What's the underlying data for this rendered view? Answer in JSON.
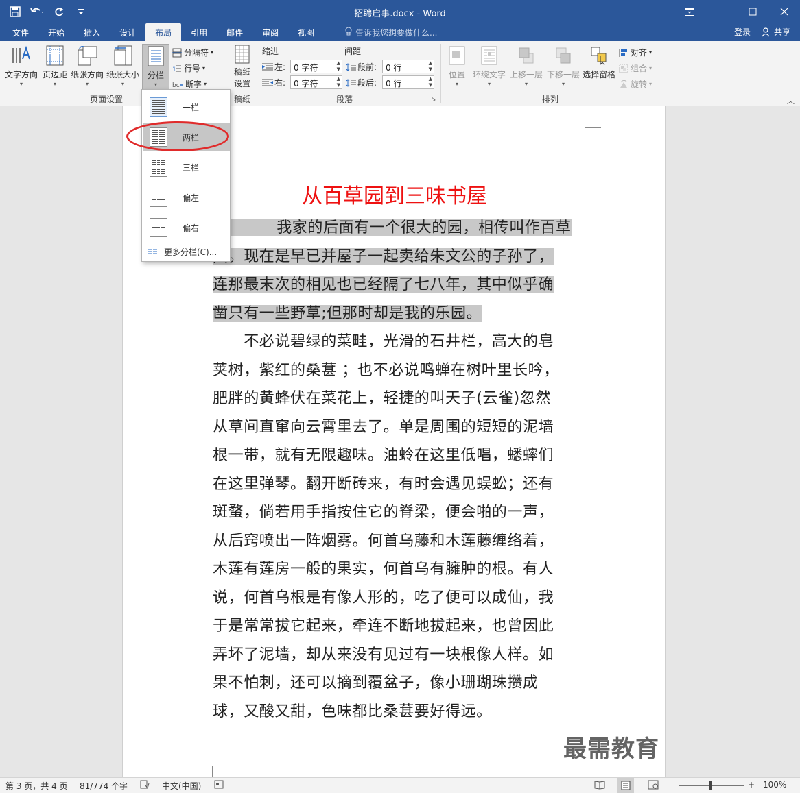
{
  "app": {
    "doc_title": "招聘启事.docx - Word",
    "qat": [
      {
        "name": "save-icon",
        "glyph": "💾"
      },
      {
        "name": "undo-icon",
        "glyph": "↶▾"
      },
      {
        "name": "redo-icon",
        "glyph": "↻"
      },
      {
        "name": "customize-qat-icon",
        "glyph": "≡"
      }
    ],
    "window_controls": {
      "restore_ribbon": "⧉",
      "minimize": "—",
      "maximize": "☐",
      "close": "✕"
    }
  },
  "tabs": [
    "文件",
    "开始",
    "插入",
    "设计",
    "布局",
    "引用",
    "邮件",
    "审阅",
    "视图"
  ],
  "active_tab": "布局",
  "tell_me": "告诉我您想要做什么...",
  "account": {
    "login": "登录",
    "share": "共享"
  },
  "ribbon": {
    "page_setup": {
      "label": "页面设置",
      "text_direction": "文字方向",
      "margins": "页边距",
      "orientation": "纸张方向",
      "size": "纸张大小",
      "columns": "分栏",
      "breaks": "分隔符",
      "line_numbers": "行号",
      "hyphenation": "断字"
    },
    "draft": {
      "label": "稿纸",
      "settings_line1": "稿纸",
      "settings_line2": "设置"
    },
    "paragraph": {
      "label": "段落",
      "indent_title": "缩进",
      "spacing_title": "间距",
      "left_label": "左:",
      "right_label": "右:",
      "before_label": "段前:",
      "after_label": "段后:",
      "left_value": "0 字符",
      "right_value": "0 字符",
      "before_value": "0 行",
      "after_value": "0 行"
    },
    "arrange": {
      "label": "排列",
      "position": "位置",
      "wrap_text": "环绕文字",
      "bring_forward": "上移一层",
      "send_backward": "下移一层",
      "selection_pane": "选择窗格",
      "align": "对齐",
      "group": "组合",
      "rotate": "旋转"
    }
  },
  "columns_menu": {
    "items": [
      "一栏",
      "两栏",
      "三栏",
      "偏左",
      "偏右"
    ],
    "selected": "一栏",
    "hovered": "两栏",
    "more": "更多分栏(C)..."
  },
  "document": {
    "title": "从百草园到三味书屋",
    "para1_lines": [
      "　　我家的后面有一个很大的园，相传叫作百草",
      "园。现在是早已并屋子一起卖给朱文公的子孙了，",
      "连那最末次的相见也已经隔了七八年，其中似乎确",
      "凿只有一些野草;但那时却是我的乐园。"
    ],
    "para2_lines": [
      "　　不必说碧绿的菜畦，光滑的石井栏，高大的皂",
      "荚树，紫红的桑葚 ；也不必说鸣蝉在树叶里长吟，",
      "肥胖的黄蜂伏在菜花上，轻捷的叫天子(云雀)忽然",
      "从草间直窜向云霄里去了。单是周围的短短的泥墙",
      "根一带，就有无限趣味。油蛉在这里低唱，蟋蟀们",
      "在这里弹琴。翻开断砖来，有时会遇见蜈蚣；还有",
      "斑蝥，倘若用手指按住它的脊梁，便会啪的一声，",
      "从后窍喷出一阵烟雾。何首乌藤和木莲藤缠络着，",
      "木莲有莲房一般的果实，何首乌有臃肿的根。有人",
      "说，何首乌根是有像人形的，吃了便可以成仙，我",
      "于是常常拔它起来，牵连不断地拔起来，也曾因此",
      "弄坏了泥墙，却从来没有见过有一块根像人样。如",
      "果不怕刺，还可以摘到覆盆子，像小珊瑚珠攒成",
      "球，又酸又甜，色味都比桑葚要好得远。"
    ]
  },
  "watermark": "最需教育",
  "status": {
    "page": "第 3 页，共 4 页",
    "words": "81/774 个字",
    "language": "中文(中国)",
    "zoom": "100%",
    "zoom_minus": "-",
    "zoom_plus": "+"
  },
  "colors": {
    "accent": "#2b579a",
    "title_red": "#ee1111",
    "highlight": "#c8c8c8",
    "annotation_red": "#e02b2b"
  }
}
